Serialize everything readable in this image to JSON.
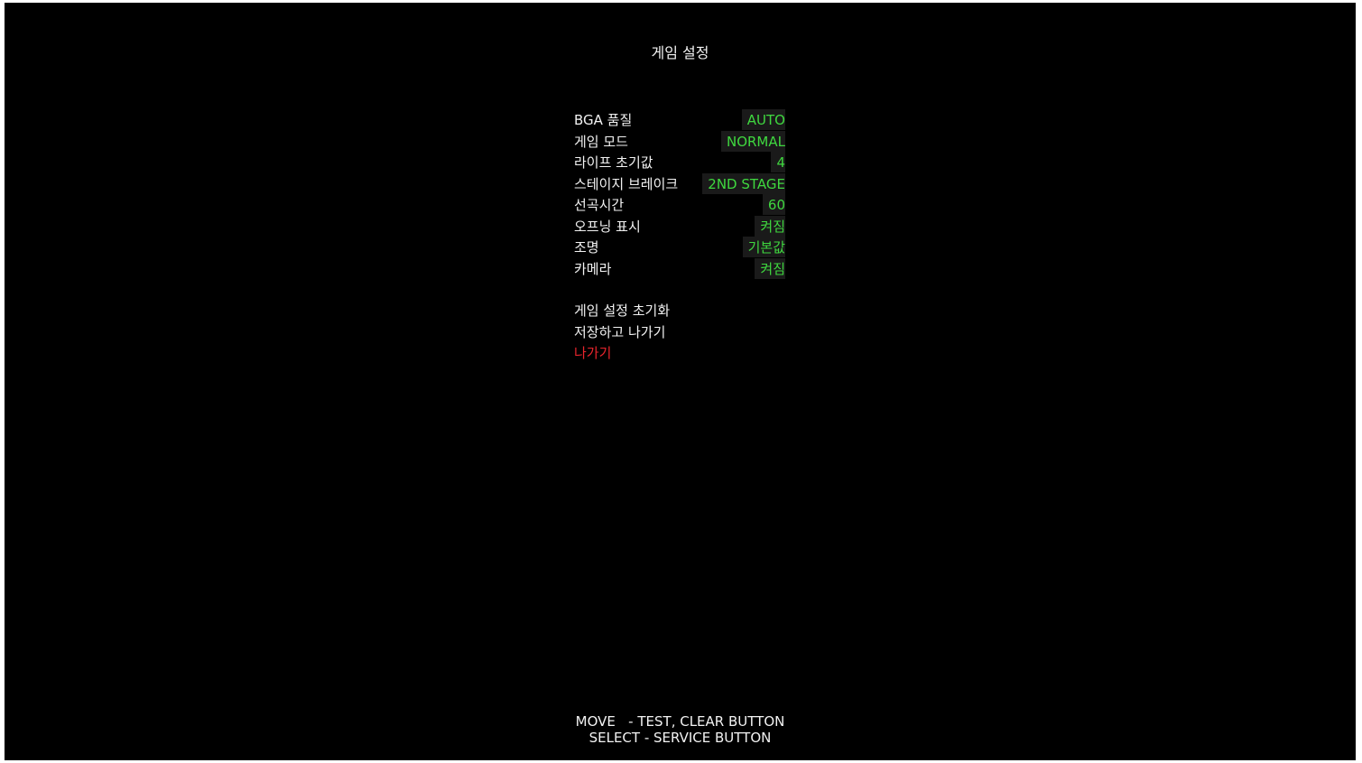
{
  "title": "게임 설정",
  "settings": [
    {
      "label": "BGA 품질",
      "value": "AUTO"
    },
    {
      "label": "게임 모드",
      "value": "NORMAL"
    },
    {
      "label": "라이프 초기값",
      "value": "4"
    },
    {
      "label": "스테이지 브레이크",
      "value": "2ND STAGE"
    },
    {
      "label": "선곡시간",
      "value": "60"
    },
    {
      "label": "오프닝 표시",
      "value": "켜짐"
    },
    {
      "label": "조명",
      "value": "기본값"
    },
    {
      "label": "카메라",
      "value": "켜짐"
    }
  ],
  "actions": [
    {
      "label": "게임 설정 초기화"
    },
    {
      "label": "저장하고 나가기"
    },
    {
      "label": "나가기",
      "selected": true
    }
  ],
  "help": {
    "line1": "MOVE   - TEST, CLEAR BUTTON",
    "line2": "SELECT - SERVICE BUTTON"
  },
  "colors": {
    "background": "#000000",
    "text": "#f2f2f2",
    "value": "#3fd83f",
    "value_bg": "#1a1a1a",
    "selected": "#e8242c"
  }
}
